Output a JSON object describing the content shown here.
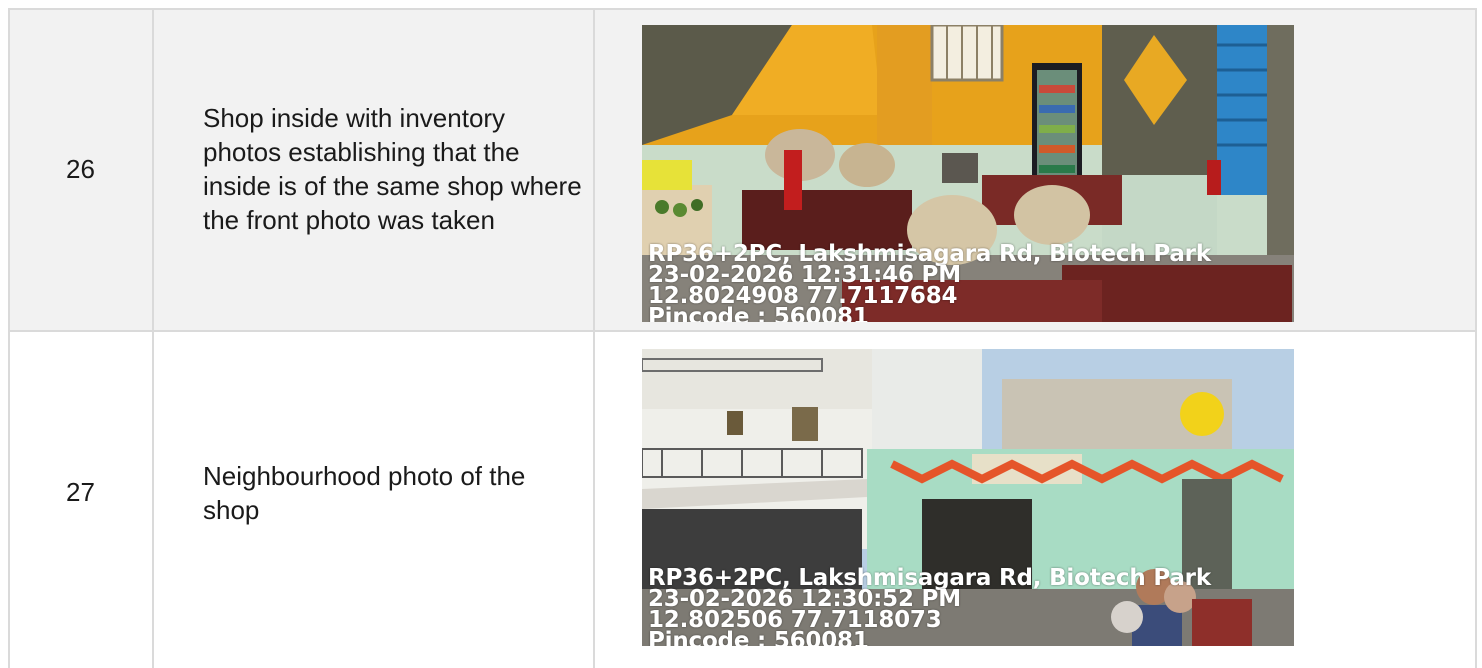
{
  "rows": [
    {
      "number": "26",
      "description": "Shop inside with inventory photos establishing that the inside is of the same shop where the front photo was taken",
      "photo": {
        "subject": "shop interior",
        "stamp": {
          "address": "RP36+2PC, Lakshmisagara Rd, Biotech Park",
          "datetime": "23-02-2026 12:31:46 PM",
          "coordinates": "12.8024908 77.7117684",
          "pincode": "Pincode : 560081"
        }
      }
    },
    {
      "number": "27",
      "description": "Neighbourhood photo of the shop",
      "photo": {
        "subject": "shop street view",
        "stamp": {
          "address": "RP36+2PC, Lakshmisagara Rd, Biotech Park",
          "datetime": "23-02-2026 12:30:52 PM",
          "coordinates": "12.802506 77.7118073",
          "pincode": "Pincode : 560081"
        }
      }
    }
  ]
}
